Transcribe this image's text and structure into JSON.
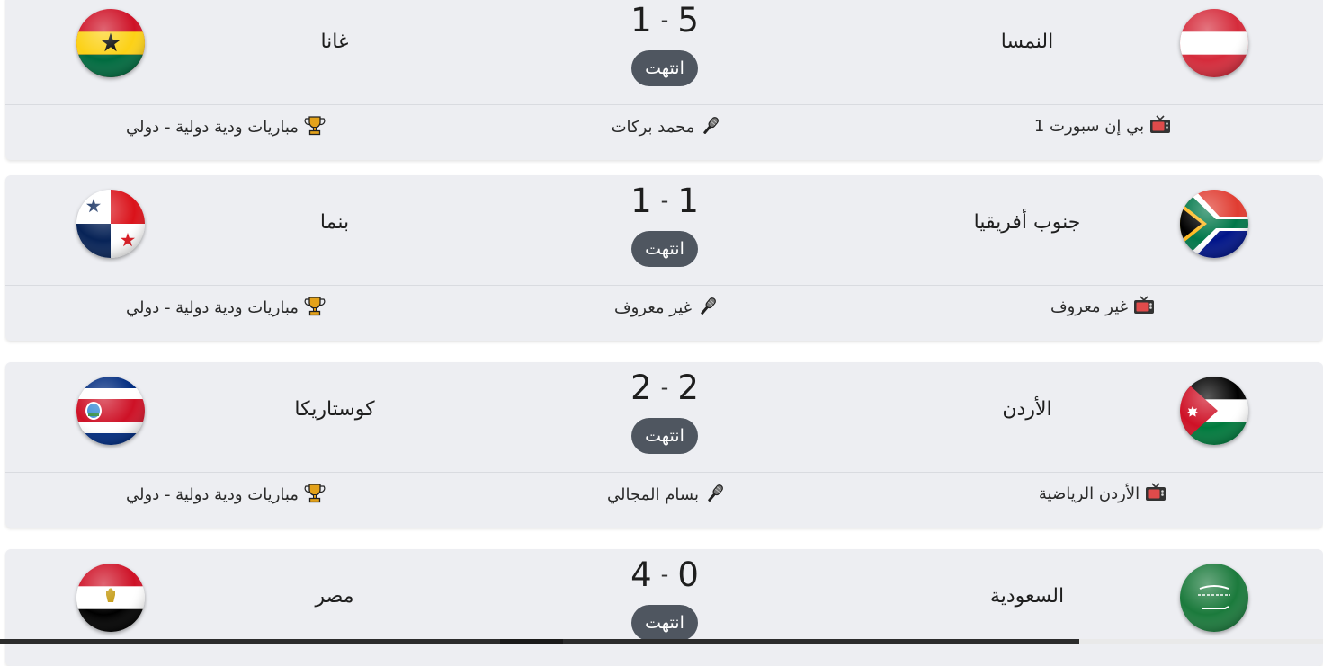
{
  "matches": [
    {
      "home_team": "النمسا",
      "away_team": "غانا",
      "home_score": "5",
      "away_score": "1",
      "status": "انتهت",
      "channel": "بي إن سبورت 1",
      "commentator": "محمد بركات",
      "competition": "مباريات ودية دولية - دولي",
      "home_flag": "austria-flag",
      "away_flag": "ghana-flag"
    },
    {
      "home_team": "جنوب أفريقيا",
      "away_team": "بنما",
      "home_score": "1",
      "away_score": "1",
      "status": "انتهت",
      "channel": "غير معروف",
      "commentator": "غير معروف",
      "competition": "مباريات ودية دولية - دولي",
      "home_flag": "south-africa-flag",
      "away_flag": "panama-flag"
    },
    {
      "home_team": "الأردن",
      "away_team": "كوستاريكا",
      "home_score": "2",
      "away_score": "2",
      "status": "انتهت",
      "channel": "الأردن الرياضية",
      "commentator": "بسام المجالي",
      "competition": "مباريات ودية دولية - دولي",
      "home_flag": "jordan-flag",
      "away_flag": "costa-rica-flag"
    },
    {
      "home_team": "السعودية",
      "away_team": "مصر",
      "home_score": "0",
      "away_score": "4",
      "status": "انتهت",
      "home_flag": "saudi-arabia-flag",
      "away_flag": "egypt-flag"
    }
  ],
  "icons": {
    "channel": "tv-icon",
    "commentator": "microphone-icon",
    "competition": "trophy-icon"
  },
  "colors": {
    "card_bg": "#edeef2",
    "status_badge_bg": "#4f5660",
    "status_badge_text": "#ffffff",
    "trophy": "#e3a21a"
  }
}
